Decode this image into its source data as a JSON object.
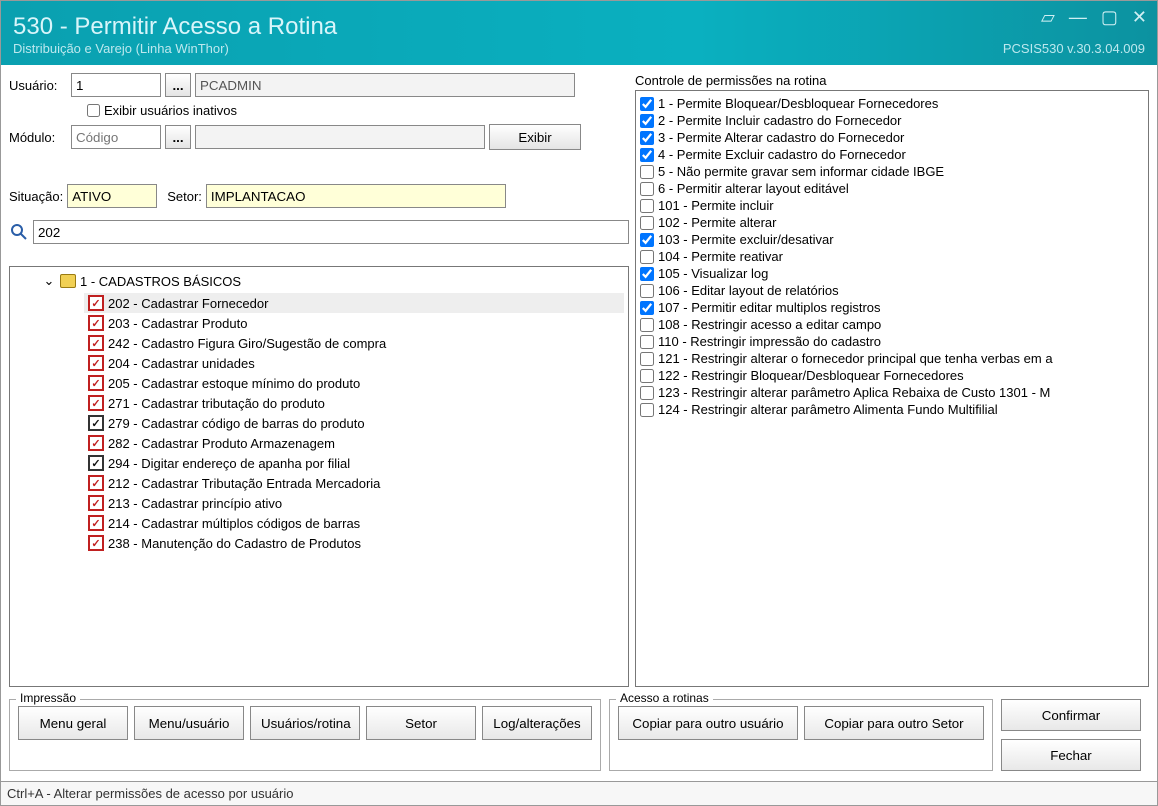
{
  "title": "530 - Permitir Acesso a Rotina",
  "subtitle": "Distribuição e Varejo (Linha WinThor)",
  "version": "PCSIS530  v.30.3.04.009",
  "labels": {
    "usuario": "Usuário:",
    "modulo": "Módulo:",
    "situacao": "Situação:",
    "setor": "Setor:",
    "exibirInativos": "Exibir usuários inativos",
    "exibir": "Exibir",
    "moduloPlaceholder": "Código"
  },
  "fields": {
    "usuarioCodigo": "1",
    "usuarioNome": "PCADMIN",
    "situacao": "ATIVO",
    "setor": "IMPLANTACAO",
    "search": "202"
  },
  "tree": {
    "rootLabel": "1 - CADASTROS BÁSICOS",
    "items": [
      {
        "label": "202 - Cadastrar  Fornecedor",
        "checked": true,
        "selected": true,
        "style": "red"
      },
      {
        "label": "203 - Cadastrar  Produto",
        "checked": true,
        "style": "red"
      },
      {
        "label": "242 - Cadastro Figura Giro/Sugestão de compra",
        "checked": true,
        "style": "red"
      },
      {
        "label": "204 - Cadastrar unidades",
        "checked": true,
        "style": "red"
      },
      {
        "label": "205 - Cadastrar estoque mínimo do produto",
        "checked": true,
        "style": "red"
      },
      {
        "label": "271 - Cadastrar tributação do produto",
        "checked": true,
        "style": "red"
      },
      {
        "label": "279 - Cadastrar código de barras do produto",
        "checked": true,
        "style": "black"
      },
      {
        "label": "282 - Cadastrar Produto Armazenagem",
        "checked": true,
        "style": "red"
      },
      {
        "label": "294 - Digitar endereço de apanha por filial",
        "checked": true,
        "style": "black"
      },
      {
        "label": "212 - Cadastrar Tributação Entrada Mercadoria",
        "checked": true,
        "style": "red"
      },
      {
        "label": "213 - Cadastrar princípio ativo",
        "checked": true,
        "style": "red"
      },
      {
        "label": "214 - Cadastrar múltiplos códigos de barras",
        "checked": true,
        "style": "red"
      },
      {
        "label": "238 - Manutenção do Cadastro de Produtos",
        "checked": true,
        "style": "red"
      }
    ]
  },
  "permissions": {
    "title": "Controle de permissões na rotina",
    "items": [
      {
        "label": "1 - Permite Bloquear/Desbloquear Fornecedores",
        "checked": true
      },
      {
        "label": "2 - Permite Incluir cadastro do Fornecedor",
        "checked": true
      },
      {
        "label": "3 - Permite Alterar cadastro do Fornecedor",
        "checked": true
      },
      {
        "label": "4 - Permite Excluir cadastro do Fornecedor",
        "checked": true
      },
      {
        "label": "5 - Não permite gravar sem informar cidade IBGE",
        "checked": false
      },
      {
        "label": "6 - Permitir alterar layout editável",
        "checked": false
      },
      {
        "label": "101 - Permite incluir",
        "checked": false
      },
      {
        "label": "102 - Permite alterar",
        "checked": false
      },
      {
        "label": "103 - Permite excluir/desativar",
        "checked": true
      },
      {
        "label": "104 - Permite reativar",
        "checked": false
      },
      {
        "label": "105 - Visualizar log",
        "checked": true
      },
      {
        "label": "106 - Editar layout de relatórios",
        "checked": false
      },
      {
        "label": "107 - Permitir editar multiplos registros",
        "checked": true
      },
      {
        "label": "108 - Restringir acesso a editar campo",
        "checked": false
      },
      {
        "label": "110 - Restringir impressão do cadastro",
        "checked": false
      },
      {
        "label": "121 - Restringir alterar o fornecedor principal que tenha verbas em a",
        "checked": false
      },
      {
        "label": "122 - Restringir Bloquear/Desbloquear Fornecedores",
        "checked": false
      },
      {
        "label": "123 - Restringir alterar parâmetro Aplica Rebaixa de Custo 1301 - M",
        "checked": false
      },
      {
        "label": "124 - Restringir alterar parâmetro Alimenta Fundo Multifilial",
        "checked": false
      }
    ]
  },
  "groups": {
    "impressao": "Impressão",
    "acesso": "Acesso a rotinas"
  },
  "buttons": {
    "menuGeral": "Menu geral",
    "menuUsuario": "Menu/usuário",
    "usuariosRotina": "Usuários/rotina",
    "setor": "Setor",
    "logAlteracoes": "Log/alterações",
    "copiarUsuario": "Copiar para outro usuário",
    "copiarSetor": "Copiar para outro Setor",
    "confirmar": "Confirmar",
    "fechar": "Fechar"
  },
  "status": "Ctrl+A - Alterar permissões de acesso por usuário"
}
